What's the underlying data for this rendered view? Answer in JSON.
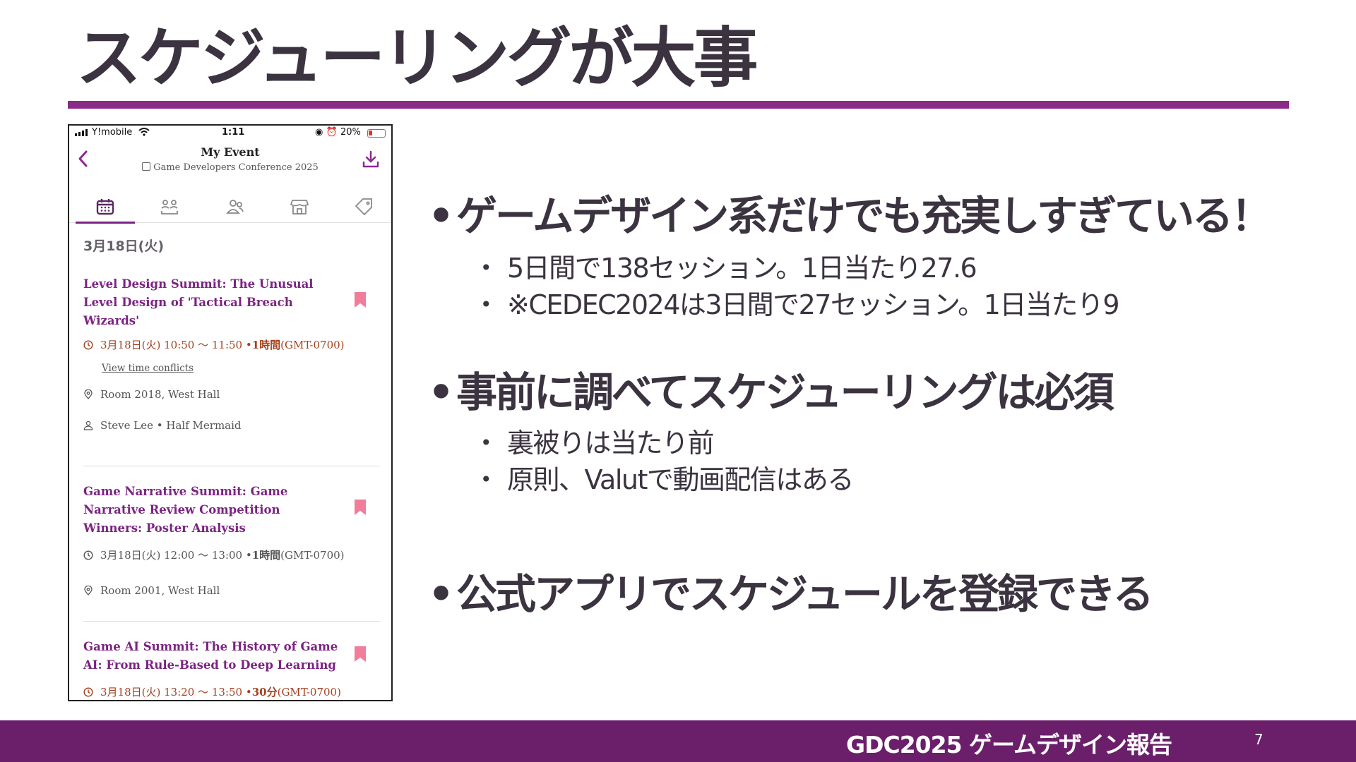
{
  "slide": {
    "title": "スケジューリングが大事",
    "footer_text": "GDC2025 ゲームデザイン報告",
    "page_number": "7"
  },
  "phone": {
    "status_bar": {
      "carrier": "Y!mobile",
      "time": "1:11",
      "battery": "20%"
    },
    "header": {
      "title": "My Event",
      "subtitle": "Game Developers Conference 2025"
    },
    "tabs": [
      "calendar-icon",
      "speakers-icon",
      "people-icon",
      "store-icon",
      "tag-icon"
    ],
    "date_heading": "3月18日(火)",
    "sessions": [
      {
        "title": "Level Design Summit: The Unusual Level Design of 'Tactical Breach Wizards'",
        "time_text": "3月18日(火) 10:50 〜 11:50 • ",
        "duration": "1時間",
        "timezone": " (GMT-0700)",
        "conflict_link": "View time conflicts",
        "location": "Room 2018, West Hall",
        "speaker": "Steve Lee • Half Mermaid"
      },
      {
        "title": "Game Narrative Summit: Game Narrative Review Competition Winners: Poster Analysis",
        "time_text": "3月18日(火) 12:00 〜 13:00 • ",
        "duration": "1時間",
        "timezone": " (GMT-0700)",
        "location": "Room 2001, West Hall"
      },
      {
        "title": "Game AI Summit: The History of Game AI: From Rule-Based to Deep Learning",
        "time_text": "3月18日(火) 13:20 〜 13:50 • ",
        "duration": "30分",
        "timezone": " (GMT-0700)"
      }
    ]
  },
  "bullets": [
    {
      "text": "ゲームデザイン系だけでも充実しすぎている！",
      "sub": [
        "5日間で138セッション。1日当たり27.6",
        "※CEDEC2024は3日間で27セッション。1日当たり9"
      ]
    },
    {
      "text": "事前に調べてスケジューリングは必須",
      "sub": [
        "裏被りは当たり前",
        "原則、Valutで動画配信はある"
      ]
    },
    {
      "text": "公式アプリでスケジュールを登録できる",
      "sub": []
    }
  ],
  "colors": {
    "accent": "#8a2b88",
    "footer": "#6b1f6b",
    "session_title": "#7b2382",
    "bookmark": "#f07d9a",
    "time_alert": "#a3401f"
  }
}
